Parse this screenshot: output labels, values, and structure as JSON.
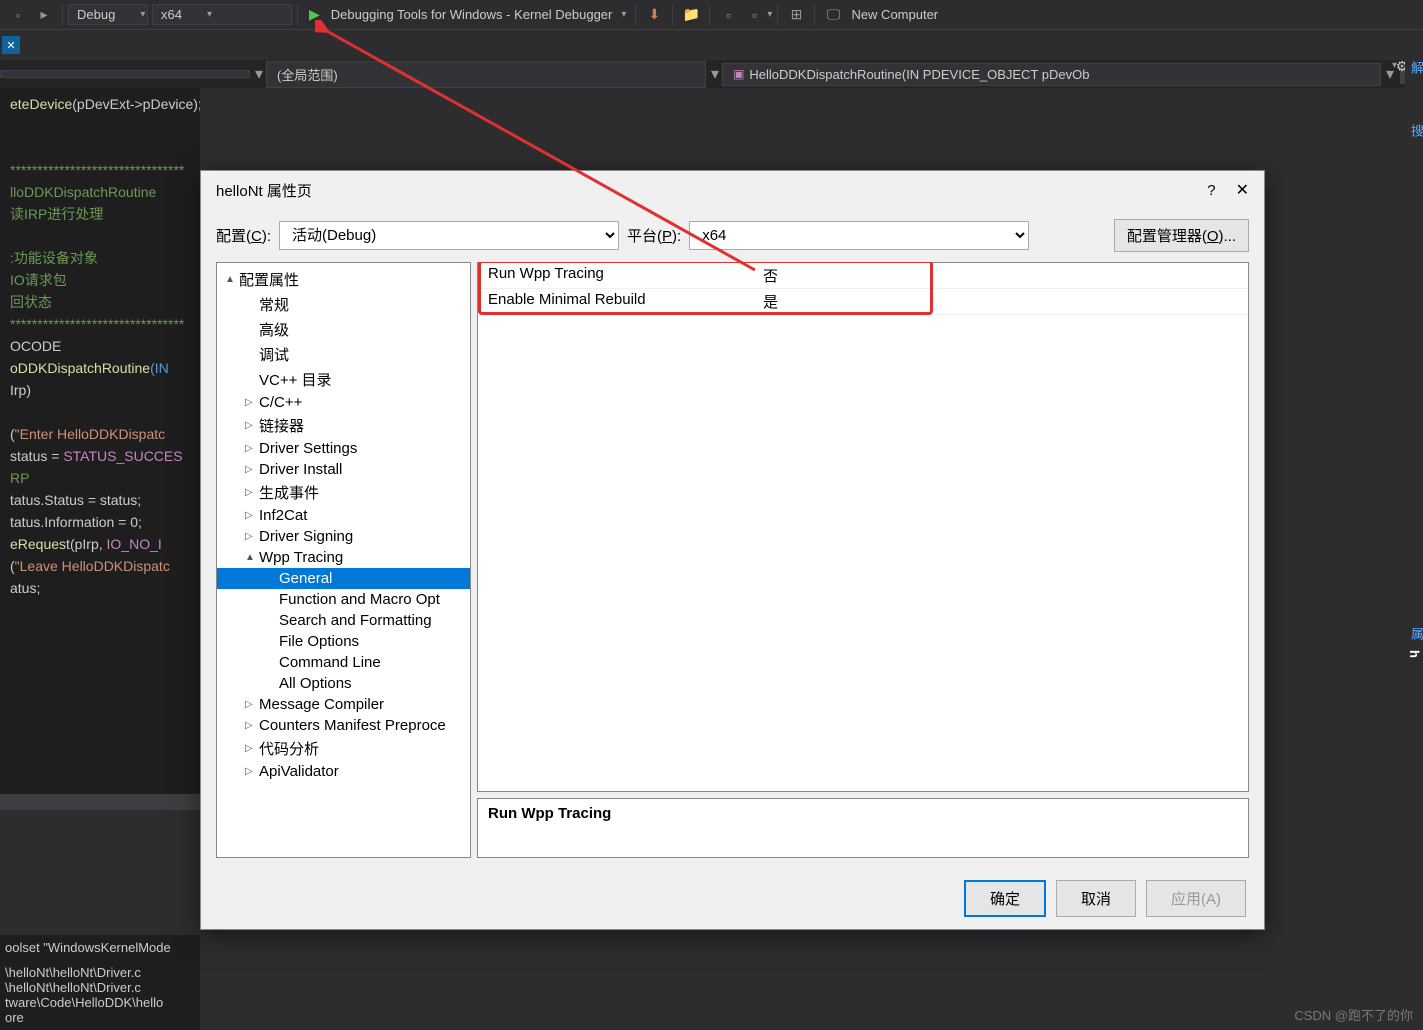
{
  "toolbar": {
    "config_dropdown": "Debug",
    "platform_dropdown": "x64",
    "debug_target": "Debugging Tools for Windows - Kernel Debugger",
    "computer_name": "New Computer"
  },
  "breadcrumb": {
    "scope": "(全局范围)",
    "function": "HelloDDKDispatchRoutine(IN PDEVICE_OBJECT pDevOb"
  },
  "code": {
    "l1a": "eteDevice",
    "l1b": "(pDevExt->pDevice);",
    "l3": "********************************",
    "l4": "lloDDKDispatchRoutine",
    "l5": "读IRP进行处理",
    "l7": ":功能设备对象",
    "l8": "IO请求包",
    "l9": "回状态",
    "l10": "********************************",
    "l11": "OCODE",
    "l12a": "oDDKDispatchRoutine",
    "l12b": "(IN",
    "l13": "Irp)",
    "l15a": "(",
    "l15b": "\"Enter HelloDDKDispatc",
    "l16a": "status = ",
    "l16b": "STATUS_SUCCES",
    "l17": "RP",
    "l18": "tatus.Status = status;",
    "l19": "tatus.Information = 0;",
    "l20a": "eRequest",
    "l20b": "(pIrp, ",
    "l20c": "IO_NO_I",
    "l21a": "(",
    "l21b": "\"Leave HelloDDKDispatc",
    "l22": "atus;"
  },
  "output": {
    "l1": "oolset \"WindowsKernelMode",
    "l2": "\\helloNt\\helloNt\\Driver.c",
    "l3": "\\helloNt\\helloNt\\Driver.c",
    "l4": "tware\\Code\\HelloDDK\\hello",
    "l5": "ore"
  },
  "right_tabs": {
    "t1": "解",
    "t2": "搜",
    "t3": "属",
    "t4": "h"
  },
  "dialog": {
    "title": "helloNt 属性页",
    "config_label": "配置(",
    "config_key": "C",
    "config_label2": "):",
    "config_value": "活动(Debug)",
    "platform_label": "平台(",
    "platform_key": "P",
    "platform_label2": "):",
    "platform_value": "x64",
    "config_mgr": "配置管理器(",
    "config_mgr_key": "O",
    "config_mgr2": ")...",
    "tree": [
      {
        "label": "配置属性",
        "level": 0,
        "expand": "▲"
      },
      {
        "label": "常规",
        "level": 1,
        "expand": ""
      },
      {
        "label": "高级",
        "level": 1,
        "expand": ""
      },
      {
        "label": "调试",
        "level": 1,
        "expand": ""
      },
      {
        "label": "VC++ 目录",
        "level": 1,
        "expand": ""
      },
      {
        "label": "C/C++",
        "level": 1,
        "expand": "▷"
      },
      {
        "label": "链接器",
        "level": 1,
        "expand": "▷"
      },
      {
        "label": "Driver Settings",
        "level": 1,
        "expand": "▷"
      },
      {
        "label": "Driver Install",
        "level": 1,
        "expand": "▷"
      },
      {
        "label": "生成事件",
        "level": 1,
        "expand": "▷"
      },
      {
        "label": "Inf2Cat",
        "level": 1,
        "expand": "▷"
      },
      {
        "label": "Driver Signing",
        "level": 1,
        "expand": "▷"
      },
      {
        "label": "Wpp Tracing",
        "level": 1,
        "expand": "▲"
      },
      {
        "label": "General",
        "level": 2,
        "expand": "",
        "selected": true
      },
      {
        "label": "Function and Macro Opt",
        "level": 2,
        "expand": ""
      },
      {
        "label": "Search and Formatting",
        "level": 2,
        "expand": ""
      },
      {
        "label": "File Options",
        "level": 2,
        "expand": ""
      },
      {
        "label": "Command Line",
        "level": 2,
        "expand": ""
      },
      {
        "label": "All Options",
        "level": 2,
        "expand": ""
      },
      {
        "label": "Message Compiler",
        "level": 1,
        "expand": "▷"
      },
      {
        "label": "Counters Manifest Preproce",
        "level": 1,
        "expand": "▷"
      },
      {
        "label": "代码分析",
        "level": 1,
        "expand": "▷"
      },
      {
        "label": "ApiValidator",
        "level": 1,
        "expand": "▷"
      }
    ],
    "props": [
      {
        "key": "Run Wpp Tracing",
        "val": "否"
      },
      {
        "key": "Enable Minimal Rebuild",
        "val": "是"
      }
    ],
    "desc_title": "Run Wpp Tracing",
    "ok": "确定",
    "cancel": "取消",
    "apply": "应用(",
    "apply_key": "A",
    "apply2": ")"
  },
  "watermark": "CSDN @跑不了的你"
}
